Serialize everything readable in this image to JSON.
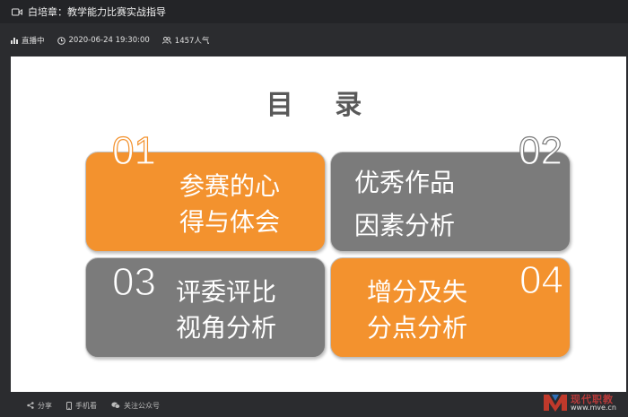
{
  "window": {
    "title": "白培章：教学能力比赛实战指导"
  },
  "meta": {
    "live_status": "直播中",
    "datetime": "2020-06-24 19:30:00",
    "viewers": "1457人气"
  },
  "slide": {
    "heading": "目 录",
    "cards": [
      {
        "number": "01",
        "line1": "参赛的心",
        "line2": "得与体会",
        "color": "#f3922e"
      },
      {
        "number": "02",
        "line1": "优秀作品",
        "line2": "因素分析",
        "color": "#7b7b7b"
      },
      {
        "number": "03",
        "line1": "评委评比",
        "line2": "视角分析",
        "color": "#7b7b7b"
      },
      {
        "number": "04",
        "line1": "增分及失",
        "line2": "分点分析",
        "color": "#f3922e"
      }
    ]
  },
  "bottombar": {
    "share": "分享",
    "mobile": "手机看",
    "follow": "关注公众号"
  },
  "watermark": {
    "brand": "现代职教",
    "url": "www.mve.cn"
  },
  "colors": {
    "accent_orange": "#f3922e",
    "card_gray": "#7b7b7b"
  }
}
